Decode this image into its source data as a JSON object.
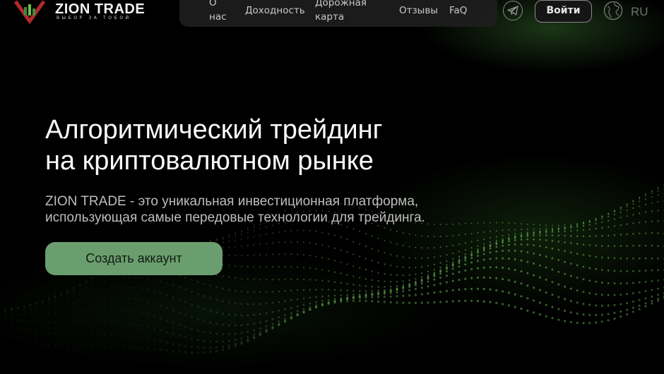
{
  "header": {
    "logo": {
      "title": "ZION TRADE",
      "subtitle": "ВЫБОР ЗА ТОБОЙ"
    },
    "nav": {
      "about": "О нас",
      "yield": "Доходность",
      "roadmap": "Дорожная карта",
      "reviews": "Отзывы",
      "faq": "FaQ"
    },
    "telegram_icon": "telegram-icon",
    "login_label": "Войти",
    "globe_icon": "globe-icon",
    "language": "RU"
  },
  "hero": {
    "title_line1": "Алгоритмический трейдинг",
    "title_line2": "на криптовалютном рынке",
    "desc_line1": "ZION TRADE - это уникальная инвестиционная платформа,",
    "desc_line2": "использующая самые передовые технологии для трейдинга.",
    "cta_label": "Создать аккаунт"
  },
  "colors": {
    "accent": "#6b9e6e",
    "background": "#000000",
    "wave": "#4f8a3e"
  }
}
